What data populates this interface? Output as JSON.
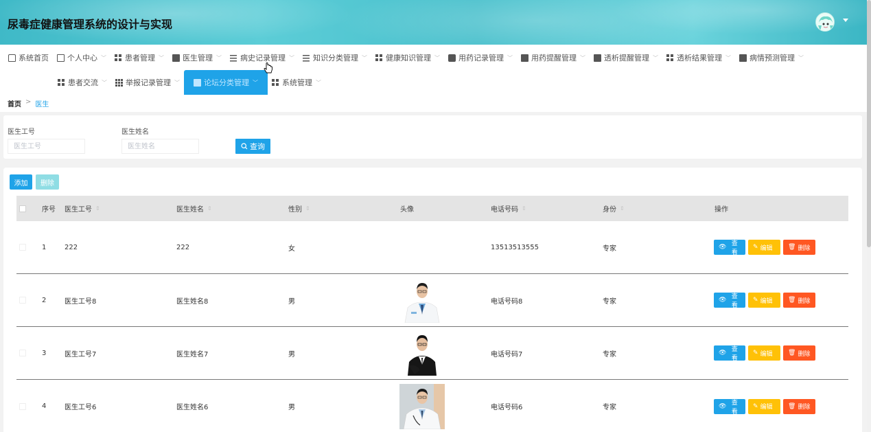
{
  "header": {
    "title": "尿毒症健康管理系统的设计与实现"
  },
  "nav": {
    "row1": [
      {
        "label": "系统首页",
        "icon": "home-icon",
        "chev": false
      },
      {
        "label": "个人中心",
        "icon": "card-icon",
        "chev": true
      },
      {
        "label": "患者管理",
        "icon": "grid-icon",
        "chev": true
      },
      {
        "label": "医生管理",
        "icon": "bag-icon",
        "chev": true
      },
      {
        "label": "病史记录管理",
        "icon": "lines-icon",
        "chev": true
      },
      {
        "label": "知识分类管理",
        "icon": "lines-icon",
        "chev": true
      },
      {
        "label": "健康知识管理",
        "icon": "grid-icon",
        "chev": true
      },
      {
        "label": "用药记录管理",
        "icon": "thumb-icon",
        "chev": true
      },
      {
        "label": "用药提醒管理",
        "icon": "doc-icon",
        "chev": true
      },
      {
        "label": "透析提醒管理",
        "icon": "doc-icon",
        "chev": true
      },
      {
        "label": "透析结果管理",
        "icon": "grid-icon",
        "chev": true
      },
      {
        "label": "病情预测管理",
        "icon": "monitor-icon",
        "chev": true
      }
    ],
    "row2": [
      {
        "label": "患者交流",
        "icon": "grid-icon"
      },
      {
        "label": "举报记录管理",
        "icon": "table-icon"
      },
      {
        "label": "论坛分类管理",
        "icon": "monitor-icon"
      },
      {
        "label": "系统管理",
        "icon": "grid-icon"
      }
    ]
  },
  "breadcrumb": {
    "home": "首页",
    "sep": ">",
    "current": "医生"
  },
  "search": {
    "field1_label": "医生工号",
    "field1_placeholder": "医生工号",
    "field2_label": "医生姓名",
    "field2_placeholder": "医生姓名",
    "search_button": "查询"
  },
  "toolbar": {
    "add_label": "添加",
    "delete_label": "删除"
  },
  "table": {
    "headers": {
      "index": "序号",
      "doc_id": "医生工号",
      "name": "医生姓名",
      "gender": "性别",
      "avatar": "头像",
      "phone": "电话号码",
      "identity": "身份",
      "actions": "操作"
    },
    "rows": [
      {
        "index": "1",
        "doc_id": "222",
        "name": "222",
        "gender": "女",
        "phone": "13513513555",
        "identity": "专家",
        "avatar": "none"
      },
      {
        "index": "2",
        "doc_id": "医生工号8",
        "name": "医生姓名8",
        "gender": "男",
        "phone": "电话号码8",
        "identity": "专家",
        "avatar": "white-coat"
      },
      {
        "index": "3",
        "doc_id": "医生工号7",
        "name": "医生姓名7",
        "gender": "男",
        "phone": "电话号码7",
        "identity": "专家",
        "avatar": "suit"
      },
      {
        "index": "4",
        "doc_id": "医生工号6",
        "name": "医生姓名6",
        "gender": "男",
        "phone": "电话号码6",
        "identity": "专家",
        "avatar": "white-coat-bg"
      }
    ],
    "view_label": "查看",
    "edit_label": "编辑",
    "delete_label": "删除"
  },
  "colors": {
    "primary": "#1fa3e8",
    "warning": "#ffc107",
    "danger": "#ff5722",
    "header_teal": "#4fc4cf"
  }
}
